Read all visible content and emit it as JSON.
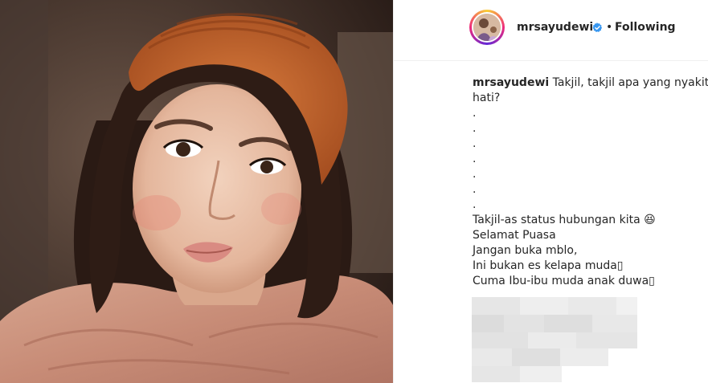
{
  "post": {
    "username": "mrsayudewi",
    "separator": "•",
    "follow_status": "Following"
  },
  "caption": {
    "user": "mrsayudewi",
    "first_line": " Takjil, takjil apa yang nyakitin",
    "lines": [
      "hati?",
      ".",
      ".",
      ".",
      ".",
      ".",
      ".",
      ".",
      "Takjil-as status hubungan kita 😆",
      "Selamat Puasa",
      "Jangan buka mblo,",
      "Ini bukan es kelapa muda▯",
      "Cuma Ibu-ibu muda anak duwa▯"
    ]
  },
  "icons": {
    "verified": "verified-badge-icon",
    "avatar": "profile-avatar"
  },
  "colors": {
    "verified": "#3897f0",
    "text": "#262626",
    "border": "#efefef"
  }
}
